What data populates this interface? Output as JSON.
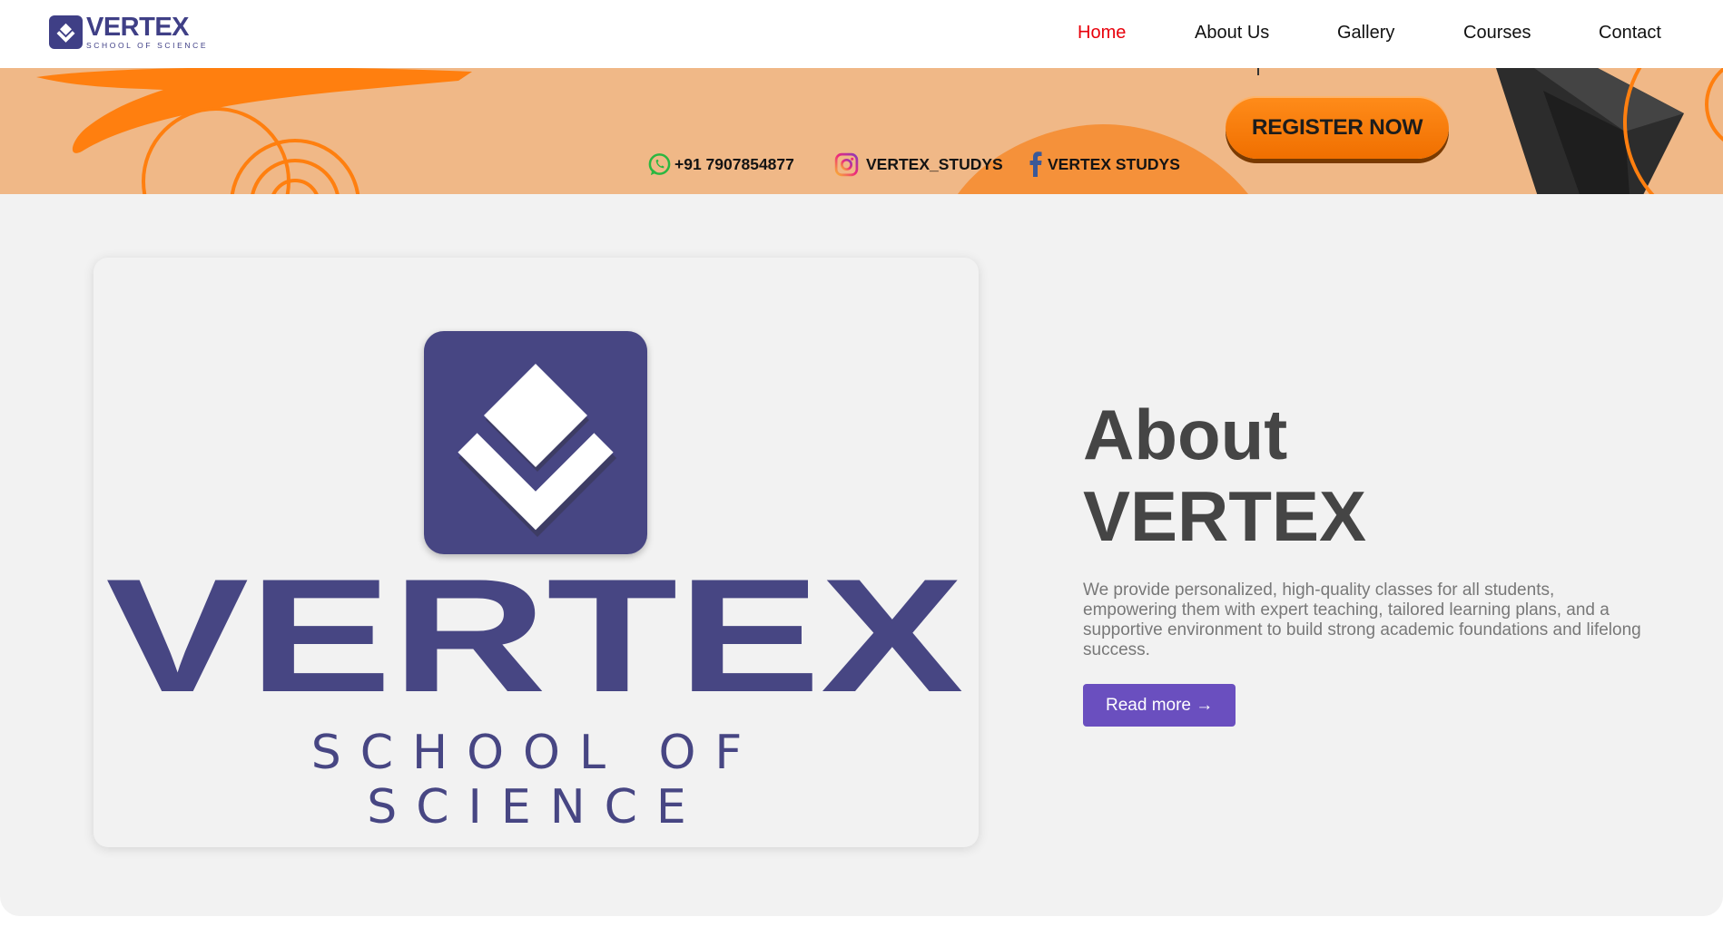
{
  "brand": {
    "name": "VERTEX",
    "subtitle": "SCHOOL OF SCIENCE",
    "icon": "vertex-logo-icon",
    "color": "#3f3f86"
  },
  "nav": {
    "items": [
      {
        "label": "Home",
        "active": true
      },
      {
        "label": "About Us",
        "active": false
      },
      {
        "label": "Gallery",
        "active": false
      },
      {
        "label": "Courses",
        "active": false
      },
      {
        "label": "Contact",
        "active": false
      }
    ],
    "active_color": "#e8000b"
  },
  "banner": {
    "contacts": [
      {
        "icon": "whatsapp-icon",
        "text": "+91 7907854877"
      },
      {
        "icon": "instagram-icon",
        "text": "VERTEX_STUDYS"
      },
      {
        "icon": "facebook-icon",
        "text": "VERTEX STUDYS"
      }
    ],
    "register_label": "REGISTER NOW",
    "colors": {
      "background": "#f0b887",
      "accent": "#ff7a00"
    }
  },
  "about": {
    "title_line1": "About",
    "title_line2": "VERTEX",
    "description": "We provide personalized, high-quality classes for all students, empowering them with expert teaching, tailored learning plans, and a supportive environment to build strong academic foundations and lifelong success.",
    "read_more_label": "Read more →",
    "logo": {
      "name": "VERTEX",
      "subtitle": "SCHOOL OF SCIENCE",
      "color": "#474683"
    }
  }
}
